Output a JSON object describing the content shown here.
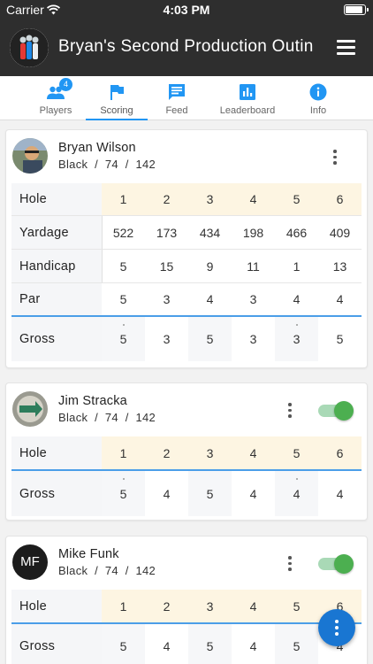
{
  "status_bar": {
    "carrier": "Carrier",
    "time": "4:03 PM"
  },
  "app_bar": {
    "title": "Bryan's Second Production Outin"
  },
  "tabs": [
    {
      "label": "Players",
      "icon": "people-icon",
      "badge": "4",
      "active": false
    },
    {
      "label": "Scoring",
      "icon": "flag-icon",
      "active": true
    },
    {
      "label": "Feed",
      "icon": "feed-icon",
      "active": false
    },
    {
      "label": "Leaderboard",
      "icon": "leaderboard-icon",
      "active": false
    },
    {
      "label": "Info",
      "icon": "info-icon",
      "active": false
    }
  ],
  "colors": {
    "accent": "#2196f3",
    "app_bar": "#2e2e2e",
    "hole_row": "#fdf5e2",
    "toggle": "#4caf50"
  },
  "labels": {
    "hole": "Hole",
    "yardage": "Yardage",
    "handicap": "Handicap",
    "par": "Par",
    "gross": "Gross"
  },
  "players": [
    {
      "name": "Bryan Wilson",
      "tee": "Black",
      "rating": "74",
      "slope": "142",
      "holes": [
        "1",
        "2",
        "3",
        "4",
        "5",
        "6"
      ],
      "yardage": [
        "522",
        "173",
        "434",
        "198",
        "466",
        "409"
      ],
      "handicap": [
        "5",
        "15",
        "9",
        "11",
        "1",
        "13"
      ],
      "par": [
        "5",
        "3",
        "4",
        "3",
        "4",
        "4"
      ],
      "gross": [
        "5",
        "3",
        "5",
        "3",
        "3",
        "5"
      ]
    },
    {
      "name": "Jim Stracka",
      "tee": "Black",
      "rating": "74",
      "slope": "142",
      "holes": [
        "1",
        "2",
        "3",
        "4",
        "5",
        "6"
      ],
      "gross": [
        "5",
        "4",
        "5",
        "4",
        "4",
        "4"
      ]
    },
    {
      "name": "Mike Funk",
      "initials": "MF",
      "tee": "Black",
      "rating": "74",
      "slope": "142",
      "holes": [
        "1",
        "2",
        "3",
        "4",
        "5",
        "6"
      ],
      "gross": [
        "5",
        "4",
        "5",
        "4",
        "5",
        "4"
      ]
    }
  ]
}
